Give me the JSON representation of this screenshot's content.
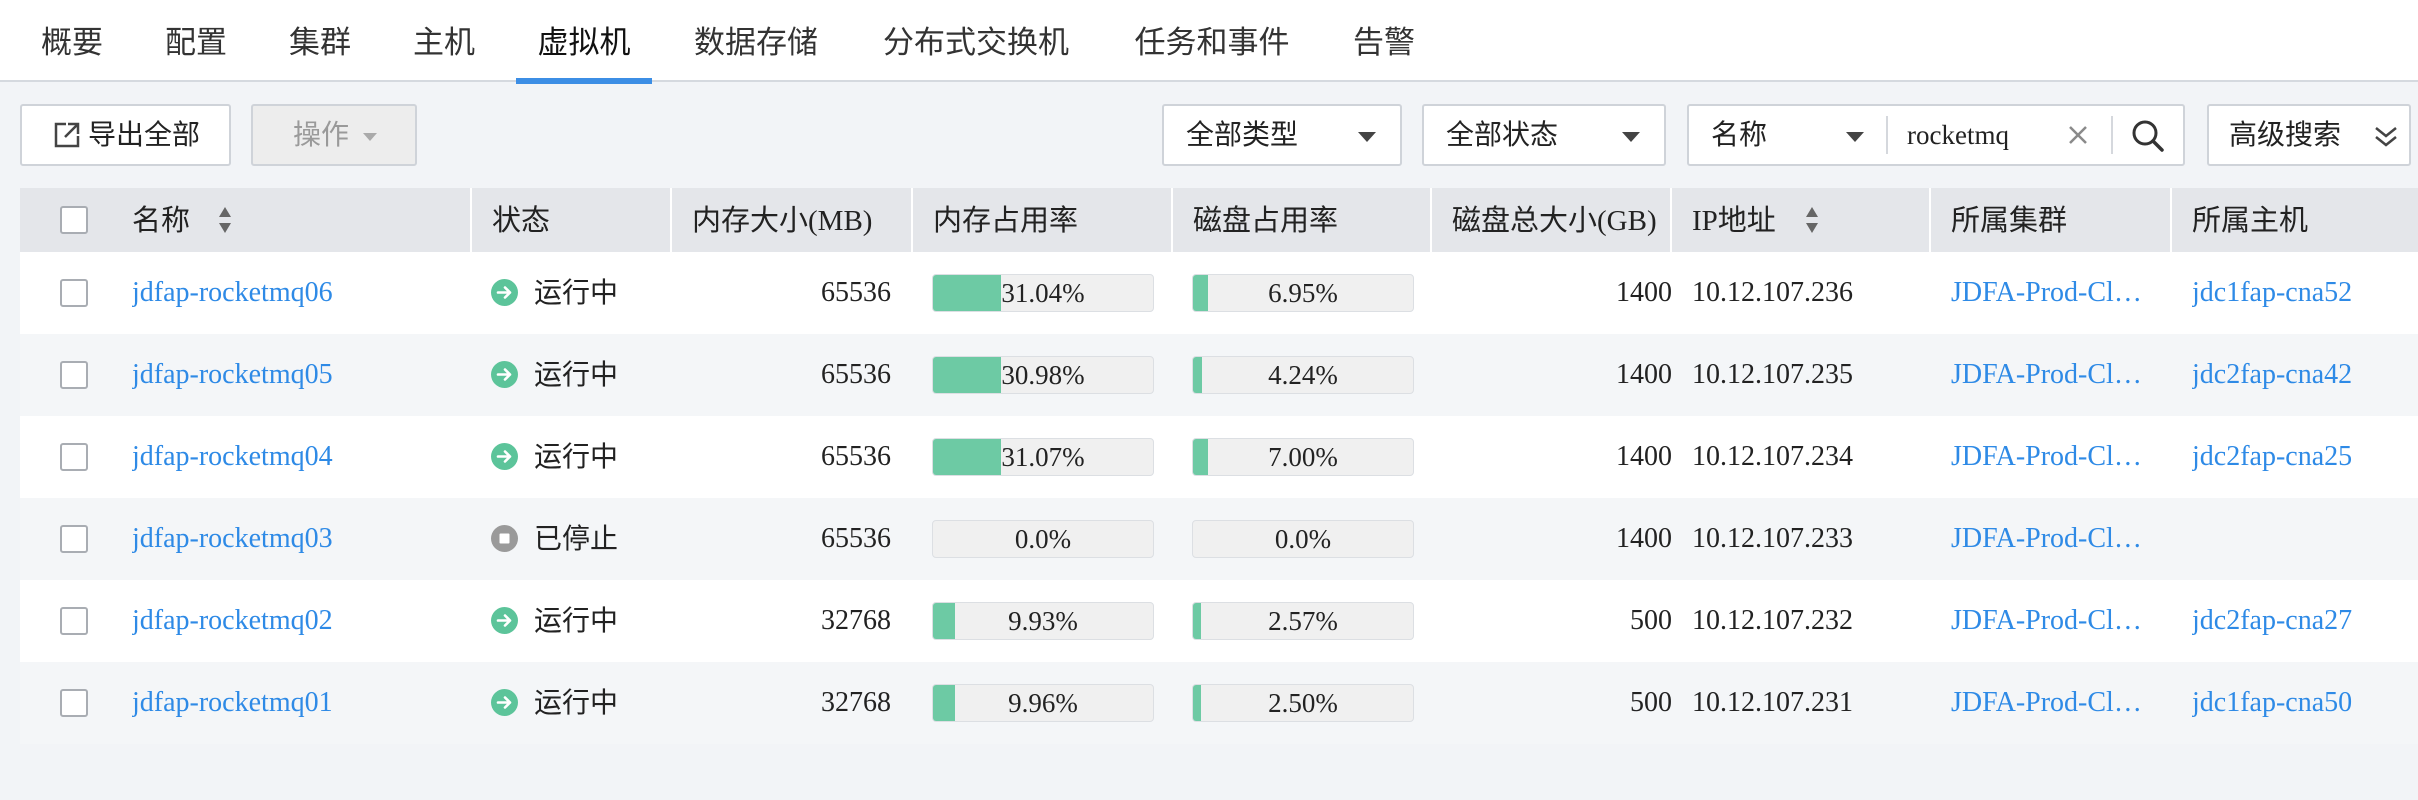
{
  "nav": {
    "tabs": [
      "概要",
      "配置",
      "集群",
      "主机",
      "虚拟机",
      "数据存储",
      "分布式交换机",
      "任务和事件",
      "告警"
    ],
    "active": "虚拟机"
  },
  "toolbar": {
    "export_label": "导出全部",
    "actions_label": "操作",
    "type_filter": "全部类型",
    "status_filter": "全部状态",
    "search_field": "名称",
    "search_value": "rocketmq",
    "advanced_label": "高级搜索"
  },
  "table": {
    "columns": [
      "名称",
      "状态",
      "内存大小(MB)",
      "内存占用率",
      "磁盘占用率",
      "磁盘总大小(GB)",
      "IP地址",
      "所属集群",
      "所属主机"
    ],
    "rows": [
      {
        "name": "jdfap-rocketmq06",
        "status": "运行中",
        "state": "running",
        "memory": "65536",
        "mem_usage": "31.04%",
        "mem_frac": 0.3104,
        "disk_usage": "6.95%",
        "disk_frac": 0.0695,
        "disk_total": "1400",
        "ip": "10.12.107.236",
        "cluster": "JDFA-Prod-Cl…",
        "host": "jdc1fap-cna52"
      },
      {
        "name": "jdfap-rocketmq05",
        "status": "运行中",
        "state": "running",
        "memory": "65536",
        "mem_usage": "30.98%",
        "mem_frac": 0.3098,
        "disk_usage": "4.24%",
        "disk_frac": 0.0424,
        "disk_total": "1400",
        "ip": "10.12.107.235",
        "cluster": "JDFA-Prod-Cl…",
        "host": "jdc2fap-cna42"
      },
      {
        "name": "jdfap-rocketmq04",
        "status": "运行中",
        "state": "running",
        "memory": "65536",
        "mem_usage": "31.07%",
        "mem_frac": 0.3107,
        "disk_usage": "7.00%",
        "disk_frac": 0.07,
        "disk_total": "1400",
        "ip": "10.12.107.234",
        "cluster": "JDFA-Prod-Cl…",
        "host": "jdc2fap-cna25"
      },
      {
        "name": "jdfap-rocketmq03",
        "status": "已停止",
        "state": "stopped",
        "memory": "65536",
        "mem_usage": "0.0%",
        "mem_frac": 0,
        "disk_usage": "0.0%",
        "disk_frac": 0,
        "disk_total": "1400",
        "ip": "10.12.107.233",
        "cluster": "JDFA-Prod-Cl…",
        "host": ""
      },
      {
        "name": "jdfap-rocketmq02",
        "status": "运行中",
        "state": "running",
        "memory": "32768",
        "mem_usage": "9.93%",
        "mem_frac": 0.0993,
        "disk_usage": "2.57%",
        "disk_frac": 0.0257,
        "disk_total": "500",
        "ip": "10.12.107.232",
        "cluster": "JDFA-Prod-Cl…",
        "host": "jdc2fap-cna27"
      },
      {
        "name": "jdfap-rocketmq01",
        "status": "运行中",
        "state": "running",
        "memory": "32768",
        "mem_usage": "9.96%",
        "mem_frac": 0.0996,
        "disk_usage": "2.50%",
        "disk_frac": 0.025,
        "disk_total": "500",
        "ip": "10.12.107.231",
        "cluster": "JDFA-Prod-Cl…",
        "host": "jdc1fap-cna50"
      }
    ]
  },
  "colors": {
    "accent": "#3c8ee5",
    "link": "#2e8ae6",
    "bar_fill": "#6dcaa4",
    "running_icon": "#5cc49a",
    "stopped_icon": "#9a9a9a"
  }
}
